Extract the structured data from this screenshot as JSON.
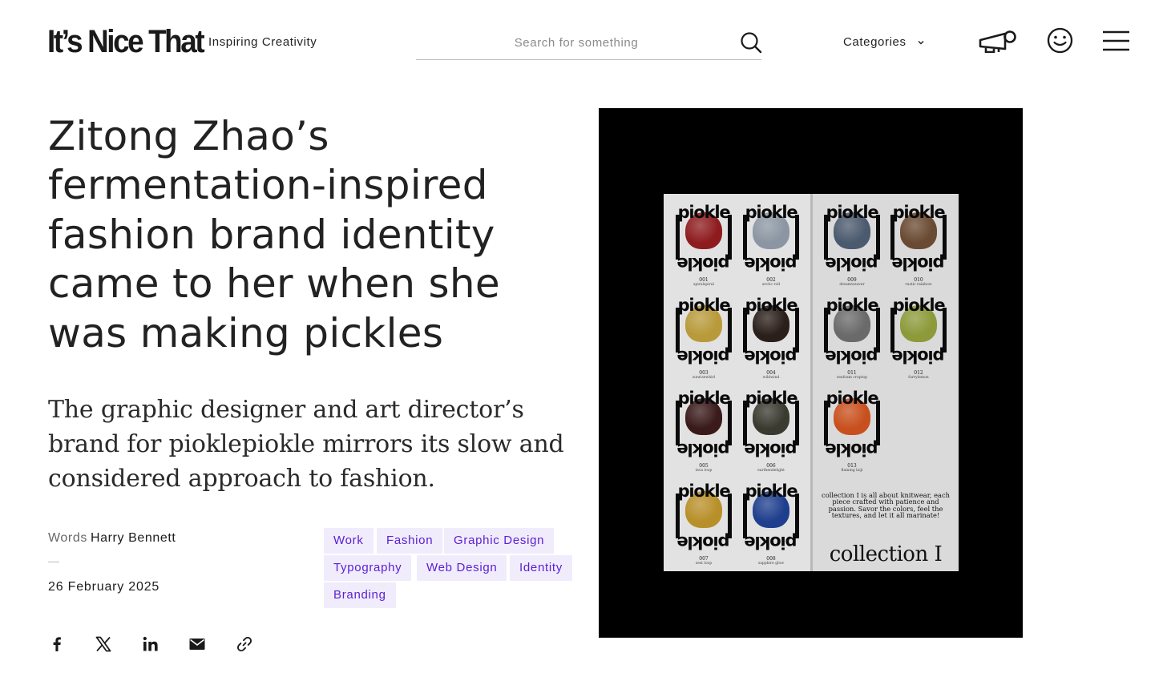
{
  "header": {
    "logo_text": "It’s Nice That",
    "tagline": "Inspiring Creativity",
    "search_placeholder": "Search for something",
    "categories_label": "Categories"
  },
  "article": {
    "title": "Zitong Zhao’s fermentation-inspired fashion brand identity came to her when she was making pickles",
    "standfirst": "The graphic designer and art director’s brand for pioklepiokle mirrors its slow and considered approach to fashion.",
    "byline_label": "Words",
    "author": "Harry Bennett",
    "date": "26 February 2025",
    "tags": [
      "Work",
      "Fashion",
      "Graphic Design",
      "Typography",
      "Web Design",
      "Identity",
      "Branding"
    ]
  },
  "share": [
    "facebook-icon",
    "x-icon",
    "linkedin-icon",
    "email-icon",
    "link-icon"
  ],
  "hero_image": {
    "brand_word": "piokle",
    "items": [
      {
        "num": "001",
        "name": "spiralspiral",
        "color": "#8e1c1f"
      },
      {
        "num": "002",
        "name": "arctic roll",
        "color": "#8c96a3"
      },
      {
        "num": "003",
        "name": "sunrisewhirl",
        "color": "#b89a3a"
      },
      {
        "num": "004",
        "name": "wildwind",
        "color": "#2a1f1a"
      },
      {
        "num": "005",
        "name": "lava loop",
        "color": "#3a1a1a"
      },
      {
        "num": "006",
        "name": "earthendelight",
        "color": "#3b3a30"
      },
      {
        "num": "007",
        "name": "zest loop",
        "color": "#b8902a"
      },
      {
        "num": "008",
        "name": "sapphire glow",
        "color": "#1f3f8e"
      },
      {
        "num": "009",
        "name": "dreamweaver",
        "color": "#4b5a6e"
      },
      {
        "num": "010",
        "name": "rustic rainbow",
        "color": "#6a4a32"
      },
      {
        "num": "011",
        "name": "seafoam croptop",
        "color": "#6a6a6a"
      },
      {
        "num": "012",
        "name": "furrylemon",
        "color": "#8c9a3a"
      },
      {
        "num": "013",
        "name": "flaming laiji",
        "color": "#c8501e"
      }
    ],
    "blurb": "collection I is all about knitwear, each piece crafted with patience and passion. Savor the colors, feel the textures, and let it all marinate!",
    "collection_title": "collection I"
  }
}
